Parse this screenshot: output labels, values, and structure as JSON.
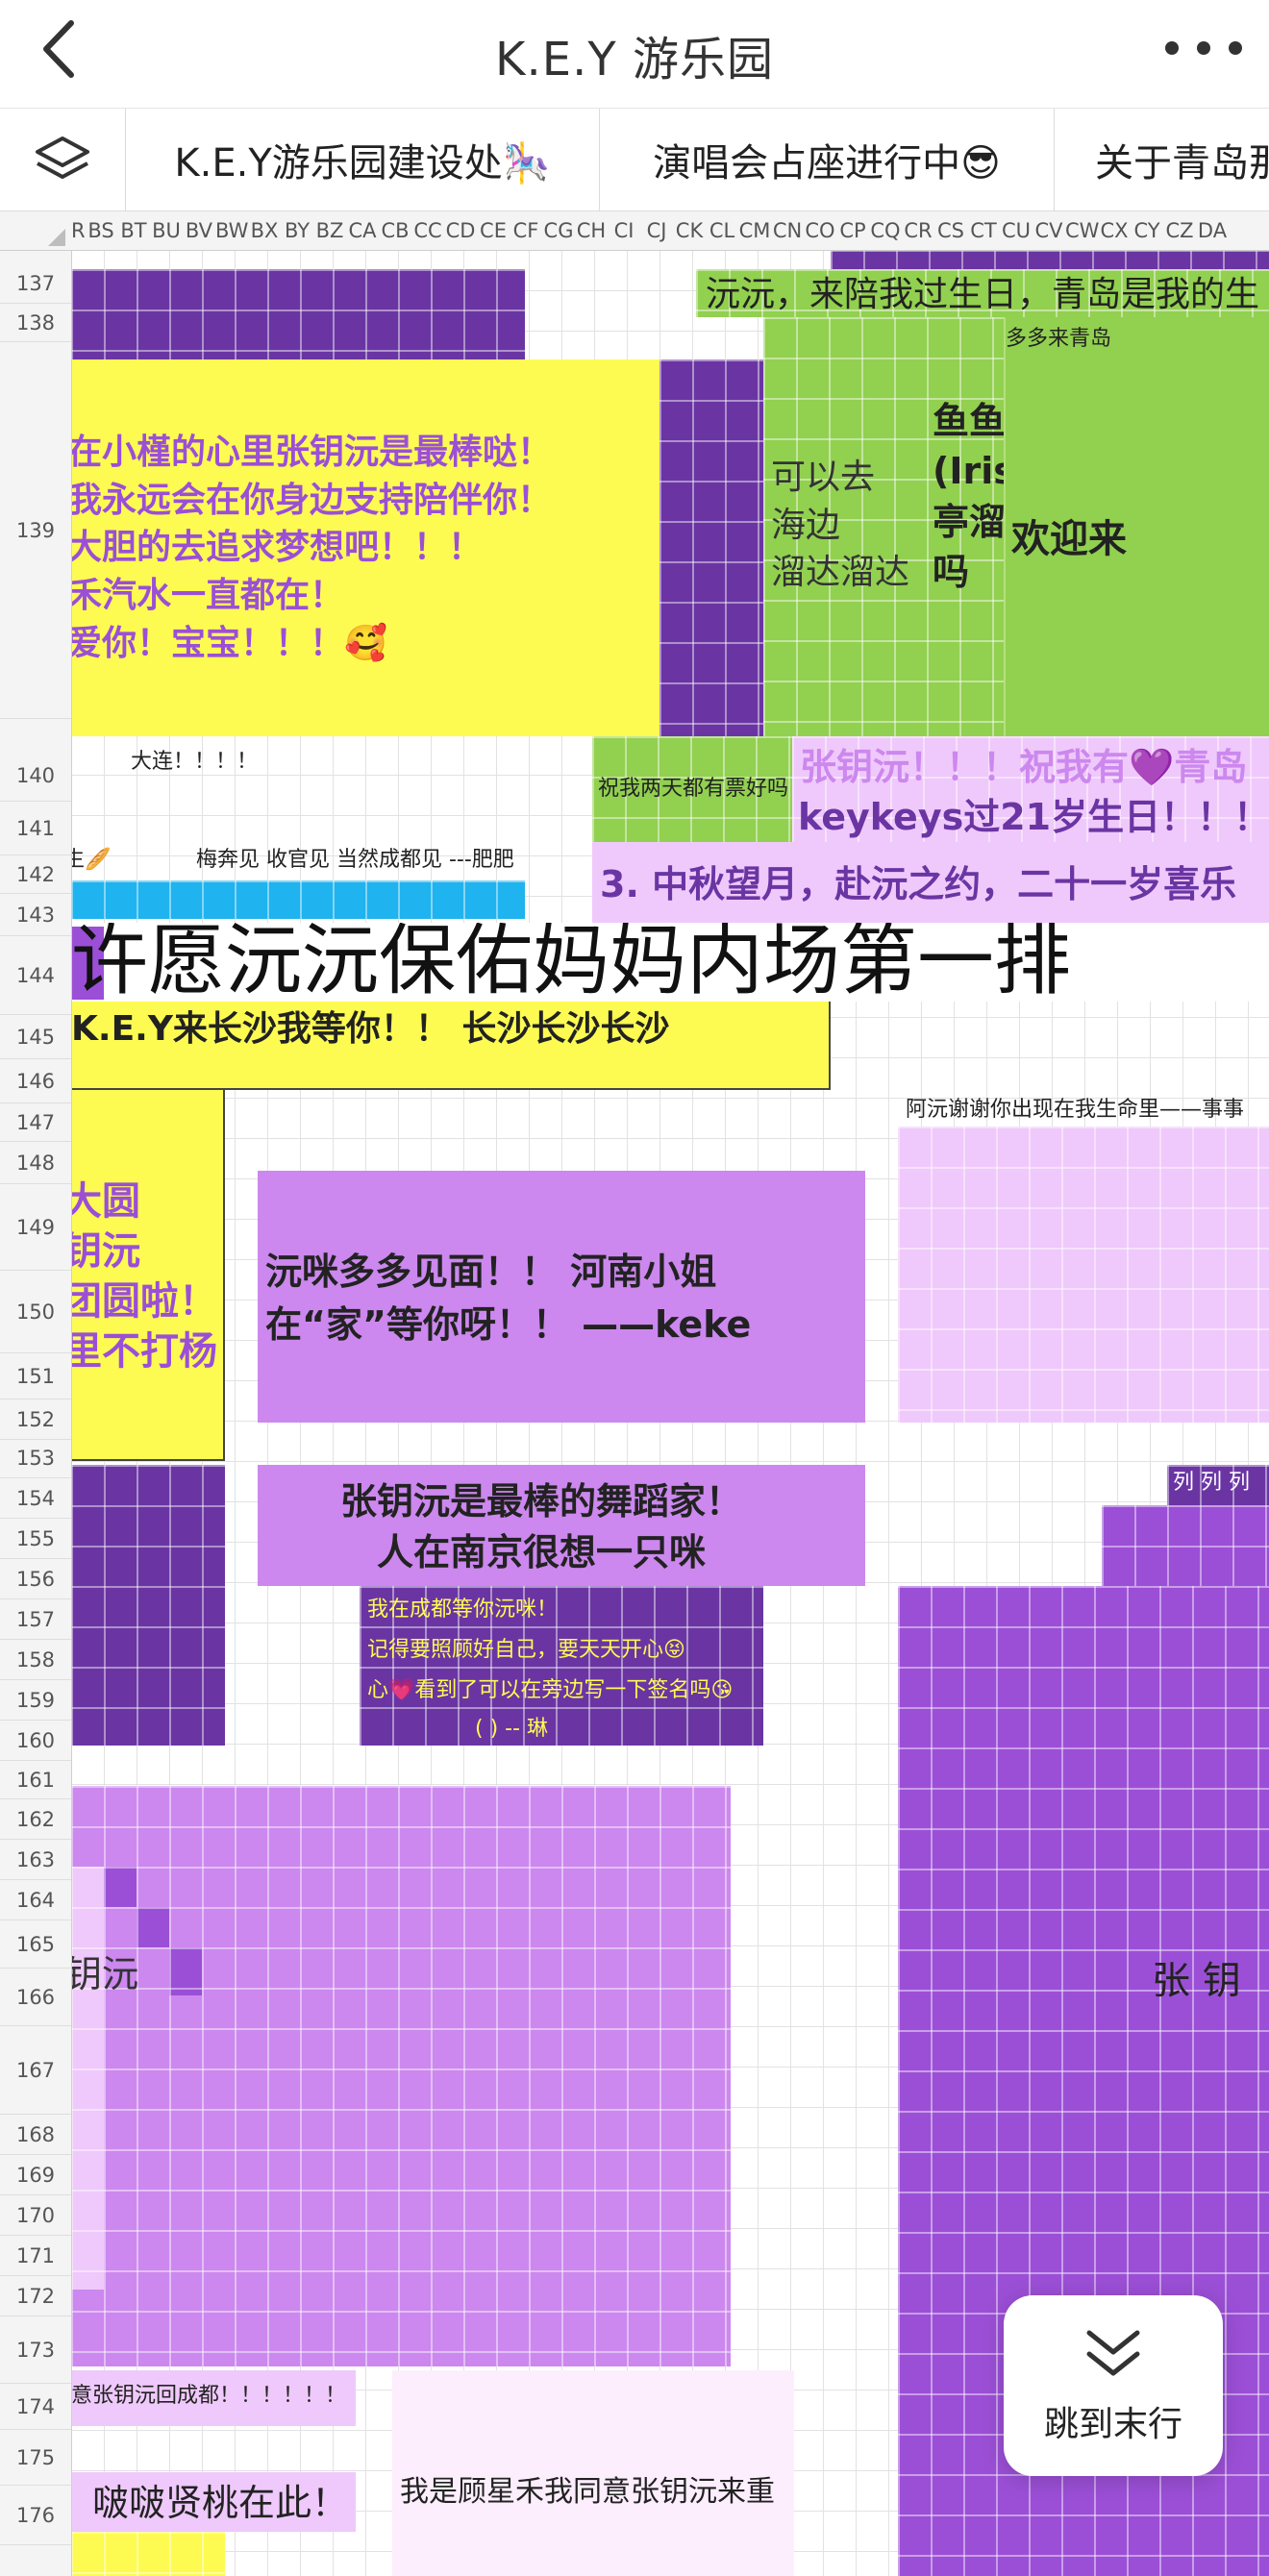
{
  "header": {
    "title": "K.E.Y 游乐园"
  },
  "tabs": [
    {
      "label": "K.E.Y游乐园建设处🎠"
    },
    {
      "label": "演唱会占座进行中😎"
    },
    {
      "label": "关于青岛那"
    }
  ],
  "columns": [
    "R",
    "BS",
    "BT",
    "BU",
    "BV",
    "BW",
    "BX",
    "BY",
    "BZ",
    "CA",
    "CB",
    "CC",
    "CD",
    "CE",
    "CF",
    "CG",
    "CH",
    "CI",
    "CJ",
    "CK",
    "CL",
    "CM",
    "CN",
    "CO",
    "CP",
    "CQ",
    "CR",
    "CS",
    "CT",
    "CU",
    "CV",
    "CW",
    "CX",
    "CY",
    "CZ",
    "DA"
  ],
  "rows": [
    "137",
    "138",
    "139",
    "140",
    "141",
    "142",
    "143",
    "144",
    "145",
    "146",
    "147",
    "148",
    "149",
    "150",
    "151",
    "152",
    "153",
    "154",
    "155",
    "156",
    "157",
    "158",
    "159",
    "160",
    "161",
    "162",
    "163",
    "164",
    "165",
    "166",
    "167",
    "168",
    "169",
    "170",
    "171",
    "172",
    "173",
    "174",
    "175",
    "176"
  ],
  "cells": {
    "c1": "沅沅，来陪我过生日，青岛是我的生",
    "c2": "多多来青岛",
    "c3": "在小槿的心里张钥沅是最棒哒！\n我永远会在你身边支持陪伴你！\n大胆的去追求梦想吧！！！\n禾汽水一直都在！\n爱你！宝宝！！！🥰",
    "c4": "可以去\n海边\n溜达溜达",
    "c5": "鱼鱼张\n(Irises.)来流\n亭溜达溜达\n吗",
    "c6": "欢迎来",
    "c7": "大连！！！！",
    "c8": "祝我两天都有票好吗",
    "c9": "张钥沅！！！祝我有💜青岛",
    "c10": "keykeys过21岁生日！！！",
    "c11": "生🥖",
    "c12": "梅奔见 收官见 当然成都见 ---肥肥",
    "c13": "3. 中秋望月，赴沅之约，二十一岁喜乐",
    "c14": "许愿沅沅保佑妈妈内场第一排",
    "c15": "K.E.Y来长沙我等你！！ 长沙长沙长沙",
    "c16": "阿沅谢谢你出现在我生命里——事事",
    "c17": "大圆\n钥沅\n团圆啦！\n里不打杨",
    "c18": "沅咪多多见面！！ 河南小姐\n在“家”等你呀！！ ——keke",
    "c19": "张钥沅是最棒的舞蹈家！\n人在南京很想一只咪",
    "c20": "列 列 列",
    "c21": "我在成都等你沅咪！",
    "c22": "记得要照顾好自己，要天天开心😝",
    "c23": "心💗看到了可以在旁边写一下签名吗😘",
    "c24": "(          )  --  琳",
    "c25": "钥沅",
    "c26": "张  钥",
    "c27": "意张钥沅回成都！！！！！！",
    "c28": "我是顾星禾我同意张钥沅来重",
    "c29": "啵啵贤桃在此！"
  },
  "jump_button": {
    "label": "跳到末行"
  },
  "colors": {
    "purple_dark": "#6a35a3",
    "purple_mid": "#9b4fd6",
    "purple_light": "#cc88ee",
    "lilac": "#efc9fb",
    "yellow": "#fdfb52",
    "green": "#92d050",
    "blue": "#1fb3ef"
  }
}
